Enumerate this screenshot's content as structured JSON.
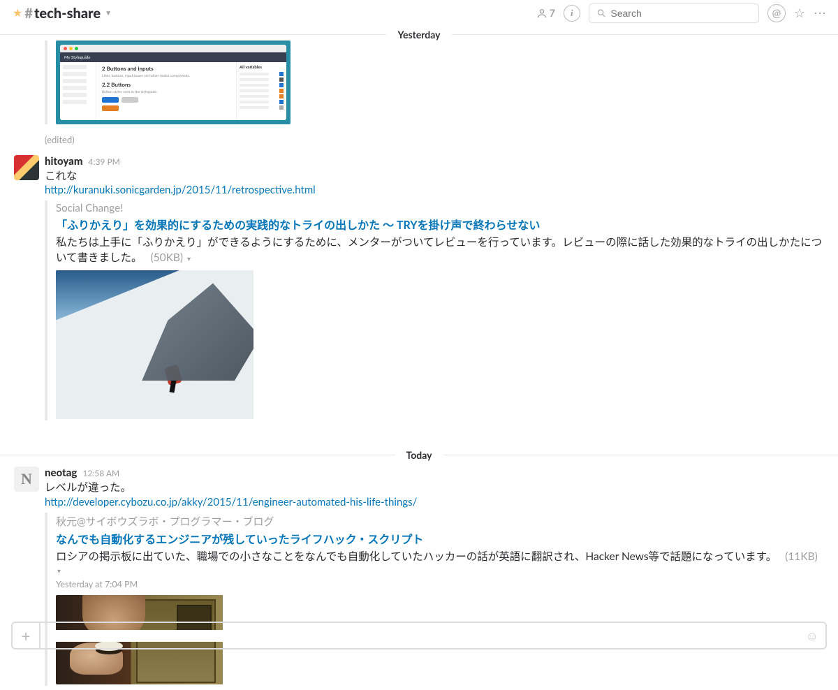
{
  "header": {
    "channel": "tech-share",
    "member_count": "7",
    "search_placeholder": "Search"
  },
  "dividers": {
    "yesterday": "Yesterday",
    "today": "Today"
  },
  "prev": {
    "edited": "(edited)",
    "styleguide": {
      "title": "My Styleguide",
      "h1": "2 Buttons and inputs",
      "sub1": "Links, buttons, input-boxes and other similar components.",
      "h2": "2.2 Buttons",
      "sub2": "Button styles used in the styleguide.",
      "right_h": "All variables"
    }
  },
  "msg1": {
    "author": "hitoyam",
    "time": "4:39 PM",
    "text": "これな",
    "link": "http://kuranuki.sonicgarden.jp/2015/11/retrospective.html",
    "att": {
      "source": "Social Change!",
      "title": "「ふりかえり」を効果的にするための実践的なトライの出しかた 〜 TRYを掛け声で終わらせない",
      "desc": "私たちは上手に「ふりかえり」ができるようにするために、メンターがついてレビューを行っています。レビューの際に話した効果的なトライの出しかたについて書きました。",
      "size": "(50KB)"
    }
  },
  "msg2": {
    "author": "neotag",
    "avatar_letter": "N",
    "time": "12:58 AM",
    "text": "レベルが違った。",
    "link": "http://developer.cybozu.co.jp/akky/2015/11/engineer-automated-his-life-things/",
    "att": {
      "source": "秋元@サイボウズラボ・プログラマー・ブログ",
      "title": "なんでも自動化するエンジニアが残していったライフハック・スクリプト",
      "desc": "ロシアの掲示板に出ていた、職場での小さなことをなんでも自動化していたハッカーの話が英語に翻訳され、Hacker News等で話題になっています。",
      "size": "(11KB)",
      "ts": "Yesterday at 7:04 PM"
    }
  }
}
